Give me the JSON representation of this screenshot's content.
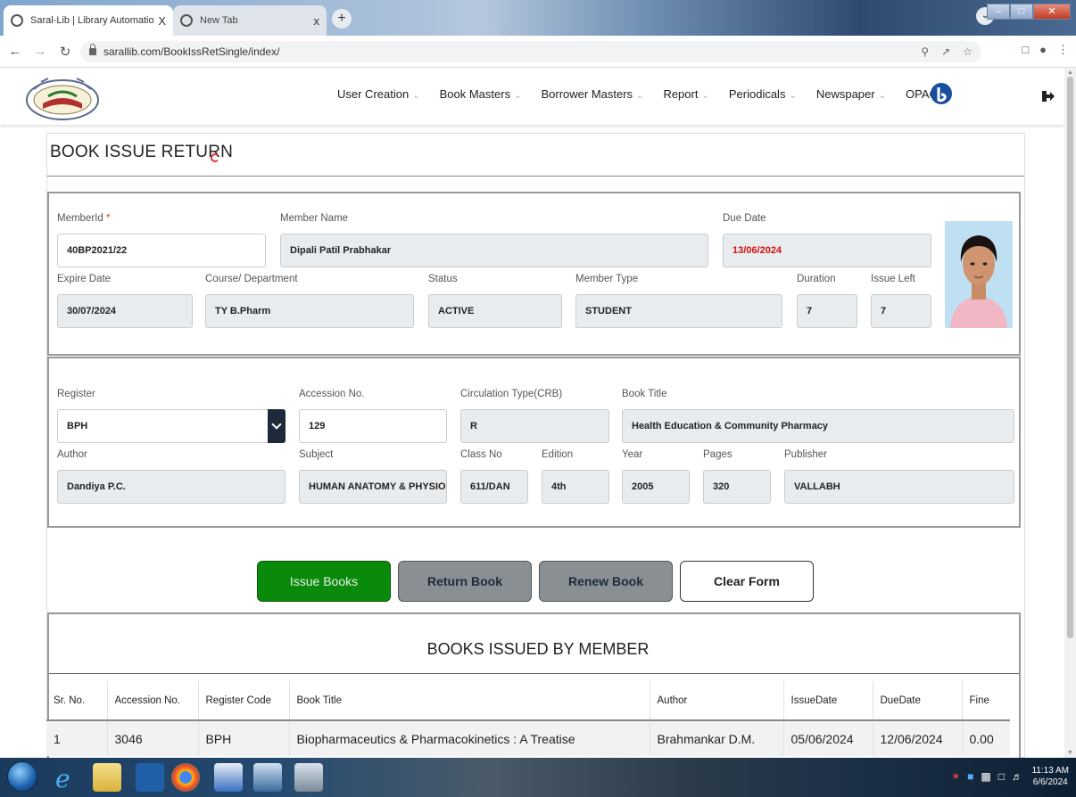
{
  "browser": {
    "tabs": [
      {
        "label": "Saral-Lib | Library Automation Sy",
        "close": "X"
      },
      {
        "label": "New Tab",
        "close": "x"
      }
    ],
    "new_tab": "+",
    "url": "sarallib.com/BookIssRetSingle/index/"
  },
  "menu": {
    "items": [
      "User Creation",
      "Book Masters",
      "Borrower Masters",
      "Report",
      "Periodicals",
      "Newspaper"
    ],
    "opac": "OPAC"
  },
  "page": {
    "title": "BOOK ISSUE RETURN"
  },
  "member": {
    "member_id_label": "MemberId",
    "member_id_req": "*",
    "member_id": "40BP2021/22",
    "member_name_label": "Member Name",
    "member_name": "Dipali Patil Prabhakar",
    "due_date_label": "Due Date",
    "due_date": "13/06/2024",
    "expire_date_label": "Expire Date",
    "expire_date": "30/07/2024",
    "course_label": "Course/ Department",
    "course": "TY B.Pharm",
    "status_label": "Status",
    "status": "ACTIVE",
    "member_type_label": "Member Type",
    "member_type": "STUDENT",
    "duration_label": "Duration",
    "duration": "7",
    "issue_left_label": "Issue Left",
    "issue_left": "7"
  },
  "book": {
    "register_label": "Register",
    "register": "BPH",
    "accession_label": "Accession No.",
    "accession": "129",
    "circulation_label": "Circulation Type(CRB)",
    "circulation": "R",
    "title_label": "Book Title",
    "title": "Health Education & Community Pharmacy",
    "author_label": "Author",
    "author": "Dandiya P.C.",
    "subject_label": "Subject",
    "subject": "HUMAN ANATOMY & PHYSIOLO",
    "class_label": "Class No",
    "class_no": "611/DAN",
    "edition_label": "Edition",
    "edition": "4th",
    "year_label": "Year",
    "year": "2005",
    "pages_label": "Pages",
    "pages": "320",
    "publisher_label": "Publisher",
    "publisher": "VALLABH"
  },
  "buttons": {
    "issue": "Issue Books",
    "return": "Return Book",
    "renew": "Renew Book",
    "clear": "Clear Form"
  },
  "issued": {
    "title": "BOOKS ISSUED BY MEMBER",
    "headers": [
      "Sr. No.",
      "Accession No.",
      "Register Code",
      "Book Title",
      "Author",
      "IssueDate",
      "DueDate",
      "Fine"
    ],
    "rows": [
      [
        "1",
        "3046",
        "BPH",
        "Biopharmaceutics & Pharmacokinetics : A Treatise",
        "Brahmankar D.M.",
        "05/06/2024",
        "12/06/2024",
        "0.00"
      ]
    ]
  },
  "taskbar": {
    "time": "11:13 AM",
    "date": "6/6/2024"
  }
}
